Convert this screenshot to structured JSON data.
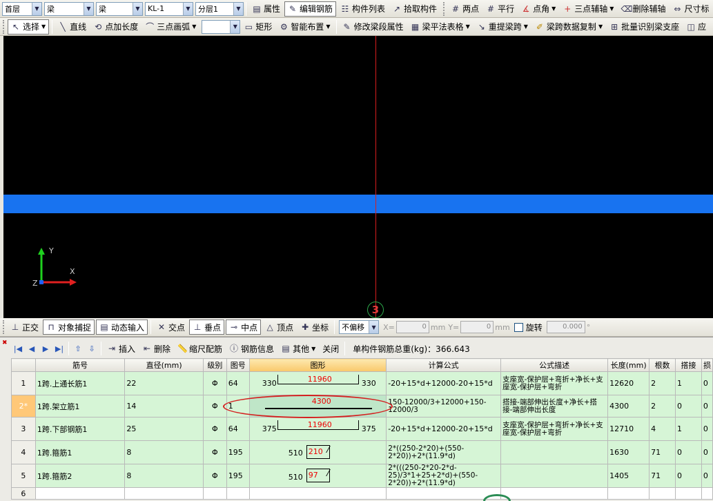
{
  "toolbar1": {
    "floor": "首层",
    "type1": "梁",
    "type2": "梁",
    "member": "KL-1",
    "layer": "分层1",
    "properties": "属性",
    "edit_rebar": "编辑钢筋",
    "component_list": "构件列表",
    "pick_component": "拾取构件",
    "two_points": "两点",
    "parallel": "平行",
    "point_angle": "点角",
    "three_point_axis": "三点辅轴",
    "delete_axis": "删除辅轴",
    "dimension": "尺寸标"
  },
  "toolbar2": {
    "select": "选择",
    "line": "直线",
    "point_extend": "点加长度",
    "three_point_arc": "三点画弧",
    "rectangle": "矩形",
    "smart_layout": "智能布置",
    "modify_span": "修改梁段属性",
    "flat_table": "梁平法表格",
    "re_extract_span": "重提梁跨",
    "span_copy": "梁跨数据复制",
    "batch_identify": "批量识别梁支座",
    "next": "应"
  },
  "canvas": {
    "axis_label": "3",
    "coord_x": "X",
    "coord_y": "Y",
    "coord_z": "Z"
  },
  "toolbar3": {
    "orthogonal": "正交",
    "snap": "对象捕捉",
    "dynamic_input": "动态输入",
    "intersection": "交点",
    "perpendicular": "垂点",
    "midpoint": "中点",
    "vertex": "顶点",
    "coordinate": "坐标",
    "offset": "不偏移",
    "x_label": "X=",
    "x_val": "0",
    "y_label": "Y=",
    "y_val": "0",
    "mm": "mm",
    "rotate": "旋转",
    "rotate_val": "0.000",
    "deg": "°"
  },
  "rebar_toolbar": {
    "insert": "插入",
    "delete": "删除",
    "scale_rebar": "缩尺配筋",
    "rebar_info": "钢筋信息",
    "other": "其他",
    "close": "关闭",
    "total_weight": "单构件钢筋总重(kg)：366.643"
  },
  "table": {
    "headers": [
      "筋号",
      "直径(mm)",
      "级别",
      "图号",
      "图形",
      "计算公式",
      "公式描述",
      "长度(mm)",
      "根数",
      "搭接",
      "损"
    ],
    "rows": [
      {
        "rn": "1",
        "name": "1跨.上通长筋1",
        "dia": "22",
        "grade": "Φ",
        "fig": "64",
        "left": "330",
        "len": "11960",
        "right": "330",
        "formula": "-20+15*d+12000-20+15*d",
        "desc": "支座宽-保护层+弯折+净长+支座宽-保护层+弯折",
        "length": "12620",
        "count": "2",
        "lap": "1",
        "loss": "0"
      },
      {
        "rn": "2*",
        "name": "1跨.架立筋1",
        "dia": "14",
        "grade": "Φ",
        "fig": "1",
        "left": "",
        "len": "4300",
        "right": "",
        "formula": "150-12000/3+12000+150-12000/3",
        "desc": "搭接-端部伸出长度+净长+搭接-端部伸出长度",
        "length": "4300",
        "count": "2",
        "lap": "0",
        "loss": "0"
      },
      {
        "rn": "3",
        "name": "1跨.下部钢筋1",
        "dia": "25",
        "grade": "Φ",
        "fig": "64",
        "left": "375",
        "len": "11960",
        "right": "375",
        "formula": "-20+15*d+12000-20+15*d",
        "desc": "支座宽-保护层+弯折+净长+支座宽-保护层+弯折",
        "length": "12710",
        "count": "4",
        "lap": "1",
        "loss": "0"
      },
      {
        "rn": "4",
        "name": "1跨.箍筋1",
        "dia": "8",
        "grade": "Φ",
        "fig": "195",
        "left": "510",
        "len": "210",
        "right": "",
        "formula": "2*((250-2*20)+(550-2*20))+2*(11.9*d)",
        "desc": "",
        "length": "1630",
        "count": "71",
        "lap": "0",
        "loss": "0"
      },
      {
        "rn": "5",
        "name": "1跨.箍筋2",
        "dia": "8",
        "grade": "Φ",
        "fig": "195",
        "left": "510",
        "len": "97",
        "right": "",
        "formula": "2*(((250-2*20-2*d-25)/3*1+25+2*d)+(550-2*20))+2*(11.9*d)",
        "desc": "",
        "length": "1405",
        "count": "71",
        "lap": "0",
        "loss": "0"
      },
      {
        "rn": "6",
        "name": "",
        "dia": "",
        "grade": "",
        "fig": "",
        "left": "",
        "len": "",
        "right": "",
        "formula": "",
        "desc": "",
        "length": "",
        "count": "",
        "lap": "",
        "loss": ""
      }
    ]
  },
  "colors": {
    "beam": "#1873f0",
    "axis_line": "#d81e1e",
    "grid_row": "#d6f5d6",
    "active_row": "#ffc878",
    "highlight": "#d42020"
  }
}
